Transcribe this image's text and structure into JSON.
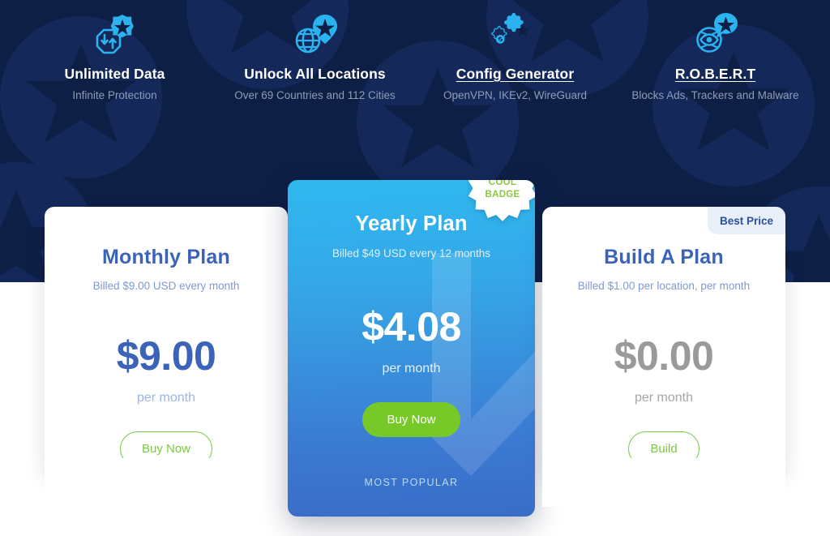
{
  "hero": {
    "background_color": "#0e1f45",
    "features": [
      {
        "icon": "unlimited-data-icon",
        "title": "Unlimited Data",
        "subtitle": "Infinite Protection",
        "is_link": false
      },
      {
        "icon": "globe-location-pin-icon",
        "title": "Unlock All Locations",
        "subtitle": "Over 69 Countries and 112 Cities",
        "is_link": false
      },
      {
        "icon": "gears-icon",
        "title": "Config Generator",
        "subtitle": "OpenVPN, IKEv2, WireGuard",
        "is_link": true
      },
      {
        "icon": "robert-eye-icon",
        "title": "R.O.B.E.R.T",
        "subtitle": "Blocks Ads, Trackers and Malware",
        "is_link": true
      }
    ]
  },
  "plans": {
    "monthly": {
      "title": "Monthly Plan",
      "billed": "Billed $9.00 USD every month",
      "price": "$9.00",
      "period": "per month",
      "cta": "Buy Now",
      "title_color": "#3b63b8",
      "price_color": "#3b63b8",
      "cta_color": "#7ac943"
    },
    "yearly": {
      "title": "Yearly Plan",
      "billed": "Billed $49 USD every 12 months",
      "price": "$4.08",
      "period": "per month",
      "cta": "Buy Now",
      "footer_label": "MOST POPULAR",
      "badge_line1": "COOL",
      "badge_line2": "BADGE",
      "badge_text_color": "#8cc63f",
      "cta_bg_color": "#76c927",
      "card_gradient_start": "#2fb8ef",
      "card_gradient_end": "#3a6cc8"
    },
    "build": {
      "title": "Build A Plan",
      "billed": "Billed $1.00 per location, per month",
      "price": "$0.00",
      "period": "per month",
      "cta": "Build",
      "ribbon_label": "Best Price",
      "title_color": "#3b63b8",
      "price_color": "#9a9a9a",
      "cta_color": "#7ac943"
    }
  }
}
